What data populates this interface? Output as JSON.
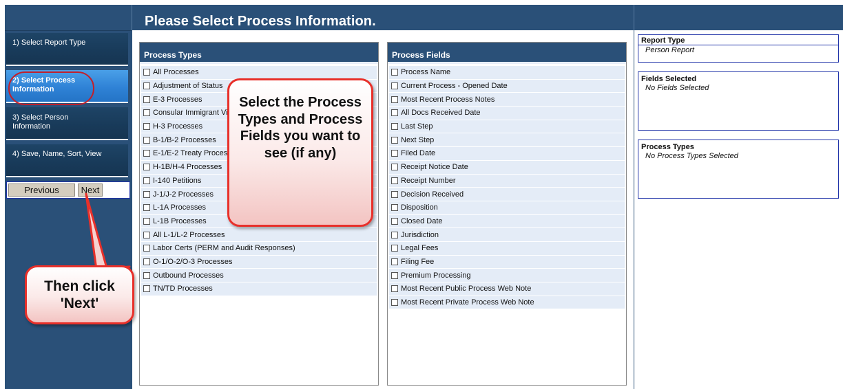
{
  "header": {
    "title": "Please Select Process Information."
  },
  "steps": [
    {
      "label": "1) Select Report Type"
    },
    {
      "label": "2) Select Process Information"
    },
    {
      "label": "3) Select Person Information"
    },
    {
      "label": "4) Save, Name, Sort, View"
    }
  ],
  "nav": {
    "previous_label": "Previous",
    "next_label": "Next"
  },
  "process_types": {
    "title": "Process Types",
    "items": [
      "All Processes",
      "Adjustment of Status",
      "E-3 Processes",
      "Consular Immigrant Visa",
      "H-3 Processes",
      "B-1/B-2 Processes",
      "E-1/E-2 Treaty Processes",
      "H-1B/H-4 Processes",
      "I-140 Petitions",
      "J-1/J-2 Processes",
      "L-1A Processes",
      "L-1B Processes",
      "All L-1/L-2 Processes",
      "Labor Certs (PERM and Audit Responses)",
      "O-1/O-2/O-3 Processes",
      "Outbound Processes",
      "TN/TD Processes"
    ]
  },
  "process_fields": {
    "title": "Process Fields",
    "items": [
      "Process Name",
      "Current Process - Opened Date",
      "Most Recent Process Notes",
      "All Docs Received Date",
      "Last Step",
      "Next Step",
      "Filed Date",
      "Receipt Notice Date",
      "Receipt Number",
      "Decision Received",
      "Disposition",
      "Closed Date",
      "Jurisdiction",
      "Legal Fees",
      "Filing Fee",
      "Premium Processing",
      "Most Recent Public Process Web Note",
      "Most Recent Private Process Web Note"
    ]
  },
  "summary": {
    "report_type_title": "Report Type",
    "report_type_value": "Person Report",
    "fields_title": "Fields Selected",
    "fields_value": "No Fields Selected",
    "types_title": "Process Types",
    "types_value": "No Process Types Selected"
  },
  "callouts": {
    "select_text": "Select the Process Types and Process Fields you want to see (if any)",
    "next_text": "Then click 'Next'"
  },
  "colors": {
    "header": "#2a5078",
    "active_step": "#2f82d6",
    "callout_border": "#e8302a"
  }
}
